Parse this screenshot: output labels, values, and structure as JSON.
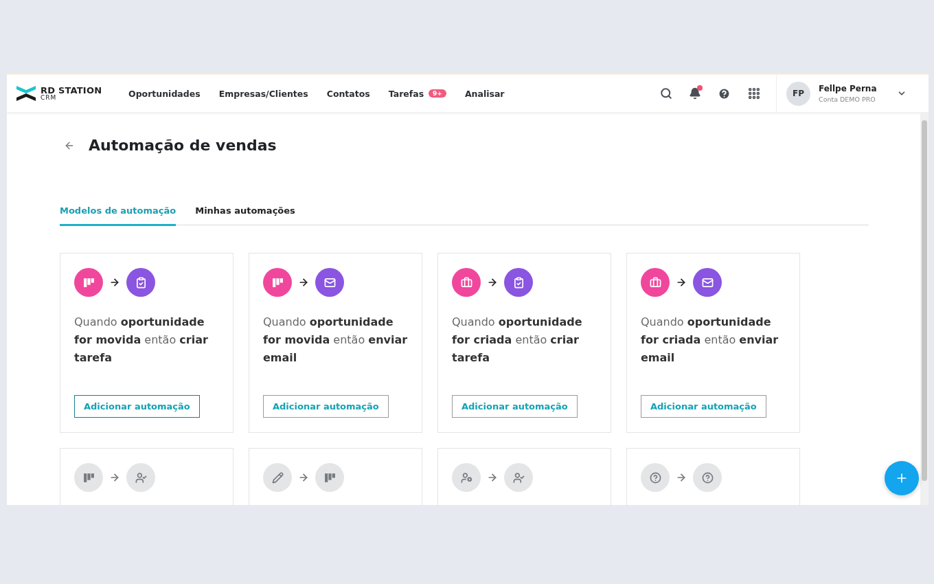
{
  "brand": {
    "name": "RD STATION",
    "sub": "CRM"
  },
  "nav": [
    {
      "label": "Oportunidades"
    },
    {
      "label": "Empresas/Clientes"
    },
    {
      "label": "Contatos"
    },
    {
      "label": "Tarefas",
      "badge": "9+"
    },
    {
      "label": "Analisar"
    }
  ],
  "header_tools": {
    "notifications_unread": true
  },
  "user": {
    "initials": "FP",
    "name": "Fellpe Perna",
    "account": "Conta DEMO PRO"
  },
  "page": {
    "title": "Automação de vendas"
  },
  "tabs": [
    {
      "label": "Modelos de automação",
      "selected": true
    },
    {
      "label": "Minhas automações",
      "selected": false
    }
  ],
  "cards": [
    {
      "steps": [
        {
          "kind": "pipeline",
          "color": "#f0479d"
        },
        {
          "kind": "task",
          "color": "#8a55e0"
        }
      ],
      "disabled": false,
      "description": "Quando **oportunidade for movida** então **criar tarefa**",
      "button": "Adicionar automação",
      "focused": true
    },
    {
      "steps": [
        {
          "kind": "pipeline",
          "color": "#f0479d"
        },
        {
          "kind": "email",
          "color": "#8a55e0"
        }
      ],
      "disabled": false,
      "description": "Quando **oportunidade for movida** então **enviar email**",
      "button": "Adicionar automação",
      "focused": false
    },
    {
      "steps": [
        {
          "kind": "briefcase",
          "color": "#f0479d"
        },
        {
          "kind": "task",
          "color": "#8a55e0"
        }
      ],
      "disabled": false,
      "description": "Quando **oportunidade for criada** então **criar tarefa**",
      "button": "Adicionar automação",
      "focused": false
    },
    {
      "steps": [
        {
          "kind": "briefcase",
          "color": "#f0479d"
        },
        {
          "kind": "email",
          "color": "#8a55e0"
        }
      ],
      "disabled": false,
      "description": "Quando **oportunidade for criada** então **enviar email**",
      "button": "Adicionar automação",
      "focused": false
    },
    {
      "steps": [
        {
          "kind": "pipeline"
        },
        {
          "kind": "usercheck"
        }
      ],
      "disabled": true
    },
    {
      "steps": [
        {
          "kind": "pencil"
        },
        {
          "kind": "pipeline"
        }
      ],
      "disabled": true
    },
    {
      "steps": [
        {
          "kind": "usergear"
        },
        {
          "kind": "usercheck"
        }
      ],
      "disabled": true
    },
    {
      "steps": [
        {
          "kind": "question"
        },
        {
          "kind": "question"
        }
      ],
      "disabled": true
    }
  ]
}
